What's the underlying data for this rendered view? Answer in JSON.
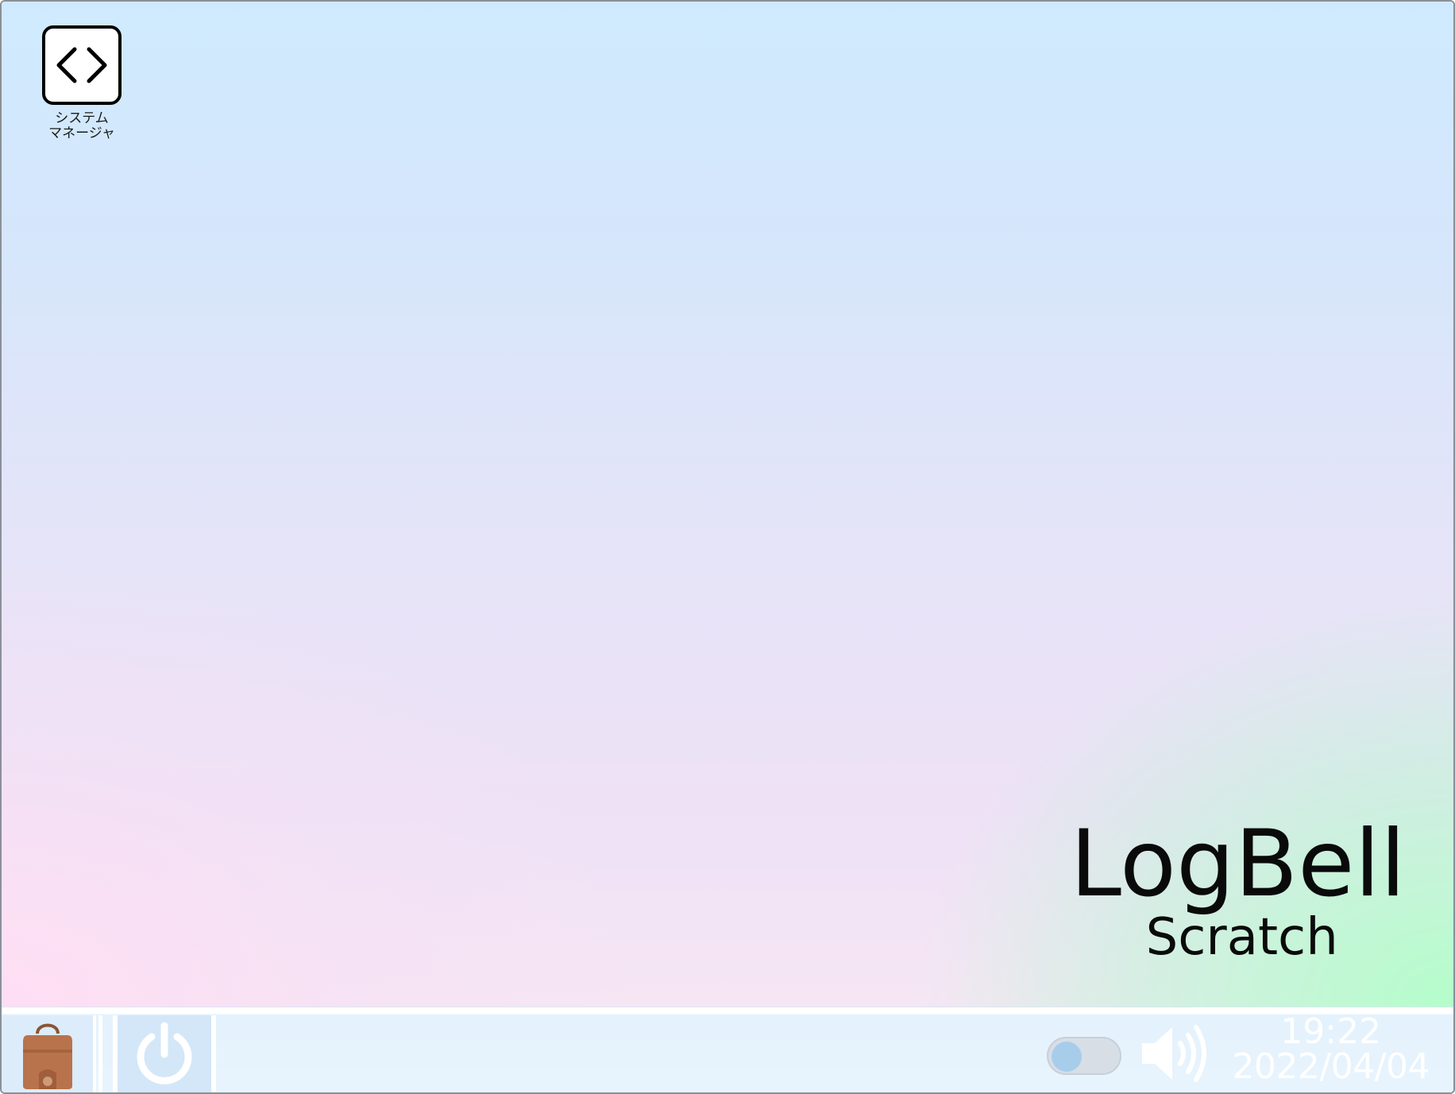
{
  "desktop": {
    "icons": [
      {
        "name": "system-manager",
        "icon": "code-brackets-icon",
        "label_line1": "システム",
        "label_line2": "マネージャ"
      }
    ],
    "brand": {
      "name": "LogBell",
      "subtitle": "Scratch"
    }
  },
  "taskbar": {
    "app_button_icon": "bag-icon",
    "power_icon": "power-icon",
    "toggle_state": "off",
    "volume_icon": "speaker-icon",
    "clock": {
      "time": "19:22",
      "date": "2022/04/04"
    }
  },
  "colors": {
    "toggle_knob": "#a7cdeb",
    "toggle_track": "#d7dee6",
    "taskbar_bg": "#e8f4fd",
    "bag": "#b8734c",
    "power_icon": "#ffffff"
  }
}
